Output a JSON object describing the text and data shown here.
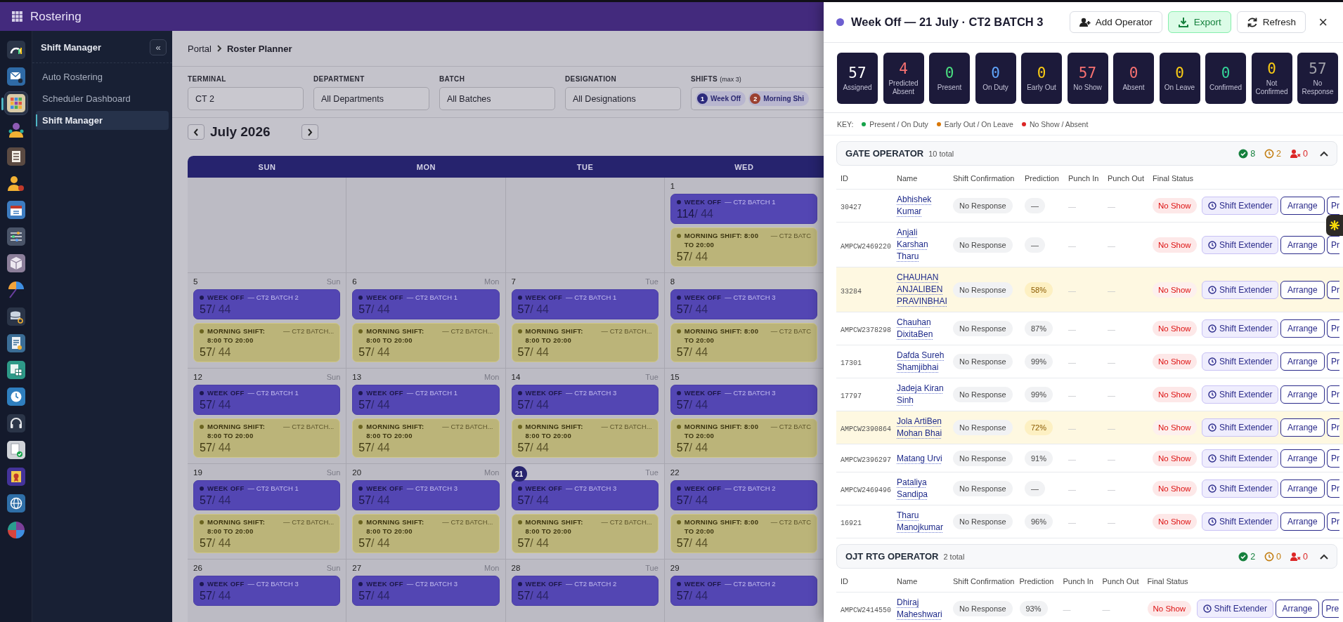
{
  "app": {
    "title": "Rostering"
  },
  "rail": [
    {
      "kind": "gauge",
      "selected": false
    },
    {
      "kind": "mail",
      "selected": false
    },
    {
      "kind": "apps",
      "selected": true
    },
    {
      "kind": "people",
      "selected": false
    },
    {
      "kind": "list",
      "selected": false
    },
    {
      "kind": "person",
      "selected": false
    },
    {
      "kind": "calendar",
      "selected": false
    },
    {
      "kind": "sliders",
      "selected": false
    },
    {
      "kind": "box",
      "selected": false
    },
    {
      "kind": "umbrella",
      "selected": false
    },
    {
      "kind": "database",
      "selected": false
    },
    {
      "kind": "report",
      "selected": false
    },
    {
      "kind": "sheet",
      "selected": false
    },
    {
      "kind": "clock",
      "selected": false
    },
    {
      "kind": "headset",
      "selected": false
    },
    {
      "kind": "approval",
      "selected": false
    },
    {
      "kind": "certificate",
      "selected": false
    },
    {
      "kind": "globe",
      "selected": false
    },
    {
      "kind": "pie",
      "selected": false
    }
  ],
  "sidebar": {
    "title": "Shift Manager",
    "collapse_label": "«",
    "items": [
      {
        "label": "Auto Rostering",
        "selected": false
      },
      {
        "label": "Scheduler Dashboard",
        "selected": false
      },
      {
        "label": "Shift Manager",
        "selected": true
      }
    ]
  },
  "breadcrumb": [
    {
      "label": "Portal",
      "current": false
    },
    {
      "label": "Roster Planner",
      "current": true
    }
  ],
  "filters": [
    {
      "label": "TERMINAL",
      "value": "CT 2"
    },
    {
      "label": "DEPARTMENT",
      "value": "All Departments"
    },
    {
      "label": "BATCH",
      "value": "All Batches"
    },
    {
      "label": "DESIGNATION",
      "value": "All Designations"
    }
  ],
  "shift_filter": {
    "label": "SHIFTS",
    "hint": "(max 3)",
    "chips": [
      {
        "number": "1",
        "label": "Week Off",
        "color": "#2c2a7c"
      },
      {
        "number": "2",
        "label": "Morning Shi",
        "color": "#9b4030"
      }
    ]
  },
  "calendar": {
    "month": "July 2026",
    "weekdays": [
      "SUN",
      "MON",
      "TUE",
      "WED"
    ],
    "weeks": [
      [
        {
          "day": "1",
          "today": false,
          "shifts": [
            {
              "kind": "week_off",
              "label": "WEEK OFF",
              "batch": "— CT2 BATCH 1",
              "headcount": "**114**/ 44"
            },
            {
              "kind": "morning",
              "label": "MORNING SHIFT: 8:00 TO 20:00",
              "batch": "— CT2 BATC",
              "headcount": "**57**/ 44"
            }
          ]
        }
      ],
      [
        {
          "day": "5",
          "weekday": "Sun",
          "today": false,
          "shifts": [
            {
              "kind": "week_off",
              "label": "WEEK OFF",
              "batch": "— CT2 BATCH 2",
              "headcount": "**57**/ 44"
            },
            {
              "kind": "morning",
              "label": "MORNING SHIFT: 8:00 TO 20:00",
              "batch": "— CT2 BATCH...",
              "headcount": "**57**/ 44"
            }
          ]
        },
        {
          "day": "6",
          "weekday": "Mon",
          "today": false,
          "shifts": [
            {
              "kind": "week_off",
              "label": "WEEK OFF",
              "batch": "— CT2 BATCH 1",
              "headcount": "**57**/ 44"
            },
            {
              "kind": "morning",
              "label": "MORNING SHIFT: 8:00 TO 20:00",
              "batch": "— CT2 BATCH...",
              "headcount": "**57**/ 44"
            }
          ]
        },
        {
          "day": "7",
          "weekday": "Tue",
          "today": false,
          "shifts": [
            {
              "kind": "week_off",
              "label": "WEEK OFF",
              "batch": "— CT2 BATCH 1",
              "headcount": "**57**/ 44"
            },
            {
              "kind": "morning",
              "label": "MORNING SHIFT: 8:00 TO 20:00",
              "batch": "— CT2 BATCH...",
              "headcount": "**57**/ 44"
            }
          ]
        },
        {
          "day": "8",
          "today": false,
          "shifts": [
            {
              "kind": "week_off",
              "label": "WEEK OFF",
              "batch": "— CT2 BATCH 3",
              "headcount": "**57**/ 44"
            },
            {
              "kind": "morning",
              "label": "MORNING SHIFT: 8:00 TO 20:00",
              "batch": "— CT2 BATC",
              "headcount": "**57**/ 44"
            }
          ]
        }
      ],
      [
        {
          "day": "12",
          "weekday": "Sun",
          "today": false,
          "shifts": [
            {
              "kind": "week_off",
              "label": "WEEK OFF",
              "batch": "— CT2 BATCH 1",
              "headcount": "**57**/ 44"
            },
            {
              "kind": "morning",
              "label": "MORNING SHIFT: 8:00 TO 20:00",
              "batch": "— CT2 BATCH...",
              "headcount": "**57**/ 44"
            }
          ]
        },
        {
          "day": "13",
          "weekday": "Mon",
          "today": false,
          "shifts": [
            {
              "kind": "week_off",
              "label": "WEEK OFF",
              "batch": "— CT2 BATCH 1",
              "headcount": "**57**/ 44"
            },
            {
              "kind": "morning",
              "label": "MORNING SHIFT: 8:00 TO 20:00",
              "batch": "— CT2 BATCH...",
              "headcount": "**57**/ 44"
            }
          ]
        },
        {
          "day": "14",
          "weekday": "Tue",
          "today": false,
          "shifts": [
            {
              "kind": "week_off",
              "label": "WEEK OFF",
              "batch": "— CT2 BATCH 3",
              "headcount": "**57**/ 44"
            },
            {
              "kind": "morning",
              "label": "MORNING SHIFT: 8:00 TO 20:00",
              "batch": "— CT2 BATCH...",
              "headcount": "**57**/ 44"
            }
          ]
        },
        {
          "day": "15",
          "today": false,
          "shifts": [
            {
              "kind": "week_off",
              "label": "WEEK OFF",
              "batch": "— CT2 BATCH 3",
              "headcount": "**57**/ 44"
            },
            {
              "kind": "morning",
              "label": "MORNING SHIFT: 8:00 TO 20:00",
              "batch": "— CT2 BATC",
              "headcount": "**57**/ 44"
            }
          ]
        }
      ],
      [
        {
          "day": "19",
          "weekday": "Sun",
          "today": false,
          "shifts": [
            {
              "kind": "week_off",
              "label": "WEEK OFF",
              "batch": "— CT2 BATCH 1",
              "headcount": "**57**/ 44"
            },
            {
              "kind": "morning",
              "label": "MORNING SHIFT: 8:00 TO 20:00",
              "batch": "— CT2 BATCH...",
              "headcount": "**57**/ 44"
            }
          ]
        },
        {
          "day": "20",
          "weekday": "Mon",
          "today": false,
          "shifts": [
            {
              "kind": "week_off",
              "label": "WEEK OFF",
              "batch": "— CT2 BATCH 3",
              "headcount": "**57**/ 44"
            },
            {
              "kind": "morning",
              "label": "MORNING SHIFT: 8:00 TO 20:00",
              "batch": "— CT2 BATCH...",
              "headcount": "**57**/ 44"
            }
          ]
        },
        {
          "day": "21",
          "weekday": "Tue",
          "today": true,
          "shifts": [
            {
              "kind": "week_off",
              "label": "WEEK OFF",
              "batch": "— CT2 BATCH 3",
              "headcount": "**57**/ 44"
            },
            {
              "kind": "morning",
              "label": "MORNING SHIFT: 8:00 TO 20:00",
              "batch": "— CT2 BATCH...",
              "headcount": "**57**/ 44"
            }
          ]
        },
        {
          "day": "22",
          "today": false,
          "shifts": [
            {
              "kind": "week_off",
              "label": "WEEK OFF",
              "batch": "— CT2 BATCH 2",
              "headcount": "**57**/ 44"
            },
            {
              "kind": "morning",
              "label": "MORNING SHIFT: 8:00 TO 20:00",
              "batch": "— CT2 BATC",
              "headcount": "**57**/ 44"
            }
          ]
        }
      ],
      [
        {
          "day": "26",
          "weekday": "Sun",
          "today": false,
          "shifts": [
            {
              "kind": "week_off",
              "label": "WEEK OFF",
              "batch": "— CT2 BATCH 3",
              "headcount": "**57**/ 44"
            }
          ]
        },
        {
          "day": "27",
          "weekday": "Mon",
          "today": false,
          "shifts": [
            {
              "kind": "week_off",
              "label": "WEEK OFF",
              "batch": "— CT2 BATCH 3",
              "headcount": "**57**/ 44"
            }
          ]
        },
        {
          "day": "28",
          "weekday": "Tue",
          "today": false,
          "shifts": [
            {
              "kind": "week_off",
              "label": "WEEK OFF",
              "batch": "— CT2 BATCH 2",
              "headcount": "**57**/ 44"
            }
          ]
        },
        {
          "day": "29",
          "today": false,
          "shifts": [
            {
              "kind": "week_off",
              "label": "WEEK OFF",
              "batch": "— CT2 BATCH 2",
              "headcount": "**57**/ 44"
            }
          ]
        }
      ]
    ]
  },
  "drawer": {
    "title": "Week Off — 21 July · CT2 BATCH 3",
    "buttons": [
      {
        "kind": "add",
        "label": "Add Operator"
      },
      {
        "kind": "export",
        "label": "Export"
      },
      {
        "kind": "refresh",
        "label": "Refresh"
      }
    ],
    "close": "×",
    "stats": [
      {
        "value": "57",
        "label": "Assigned",
        "color": "#ffffff"
      },
      {
        "value": "4",
        "label": "Predicted Absent",
        "color": "#f87171"
      },
      {
        "value": "0",
        "label": "Present",
        "color": "#4ade80"
      },
      {
        "value": "0",
        "label": "On Duty",
        "color": "#60a5fa"
      },
      {
        "value": "0",
        "label": "Early Out",
        "color": "#facc15"
      },
      {
        "value": "57",
        "label": "No Show",
        "color": "#f87171"
      },
      {
        "value": "0",
        "label": "Absent",
        "color": "#f87171"
      },
      {
        "value": "0",
        "label": "On Leave",
        "color": "#facc15"
      },
      {
        "value": "0",
        "label": "Confirmed",
        "color": "#34d399"
      },
      {
        "value": "0",
        "label": "Not Confirmed",
        "color": "#facc15"
      },
      {
        "value": "57",
        "label": "No Response",
        "color": "#a1a1aa"
      }
    ],
    "key_title": "KEY:",
    "key": [
      {
        "label": "Present / On Duty",
        "color": "#16a34a"
      },
      {
        "label": "Early Out / On Leave",
        "color": "#d97706"
      },
      {
        "label": "No Show / Absent",
        "color": "#dc2626"
      }
    ],
    "groups": [
      {
        "title": "GATE OPERATOR",
        "total": "10 total",
        "expanded": true,
        "counts": [
          {
            "kind": "ok",
            "value": "8"
          },
          {
            "kind": "pending",
            "value": "2"
          },
          {
            "kind": "absent",
            "value": "0"
          }
        ],
        "columns": [
          "ID",
          "Name",
          "Shift Confirmation",
          "Prediction",
          "Punch In",
          "Punch Out",
          "Final Status"
        ],
        "rows": [
          {
            "id": "30427",
            "name": "Abhishek Kumar",
            "confirmation": "No Response",
            "prediction": "—",
            "punch_in": "—",
            "punch_out": "—",
            "final_status": "No Show",
            "flagged": false,
            "actions": [
              "Shift Extender",
              "Arrange",
              "Pr"
            ]
          },
          {
            "id": "AMPCW2469220",
            "name": "Anjali Karshan Tharu",
            "confirmation": "No Response",
            "prediction": "—",
            "punch_in": "—",
            "punch_out": "—",
            "final_status": "No Show",
            "flagged": false,
            "actions": [
              "Shift Extender",
              "Arrange",
              "Pr"
            ]
          },
          {
            "id": "33284",
            "name": "CHAUHAN ANJALIBEN PRAVINBHAI",
            "confirmation": "No Response",
            "prediction": "58%",
            "punch_in": "—",
            "punch_out": "—",
            "final_status": "No Show",
            "flagged": true,
            "actions": [
              "Shift Extender",
              "Arrange",
              "Pr"
            ]
          },
          {
            "id": "AMPCW2378298",
            "name": "Chauhan DixitaBen",
            "confirmation": "No Response",
            "prediction": "87%",
            "punch_in": "—",
            "punch_out": "—",
            "final_status": "No Show",
            "flagged": false,
            "actions": [
              "Shift Extender",
              "Arrange",
              "Pr"
            ]
          },
          {
            "id": "17301",
            "name": "Dafda Sureh Shamjibhai",
            "confirmation": "No Response",
            "prediction": "99%",
            "punch_in": "—",
            "punch_out": "—",
            "final_status": "No Show",
            "flagged": false,
            "actions": [
              "Shift Extender",
              "Arrange",
              "Pr"
            ]
          },
          {
            "id": "17797",
            "name": "Jadeja Kiran Sinh",
            "confirmation": "No Response",
            "prediction": "99%",
            "punch_in": "—",
            "punch_out": "—",
            "final_status": "No Show",
            "flagged": false,
            "actions": [
              "Shift Extender",
              "Arrange",
              "Pr"
            ]
          },
          {
            "id": "AMPCW2390864",
            "name": "Jola ArtiBen Mohan Bhai",
            "confirmation": "No Response",
            "prediction": "72%",
            "punch_in": "—",
            "punch_out": "—",
            "final_status": "No Show",
            "flagged": true,
            "actions": [
              "Shift Extender",
              "Arrange",
              "Pr"
            ]
          },
          {
            "id": "AMPCW2396297",
            "name": "Matang Urvi",
            "confirmation": "No Response",
            "prediction": "91%",
            "punch_in": "—",
            "punch_out": "—",
            "final_status": "No Show",
            "flagged": false,
            "actions": [
              "Shift Extender",
              "Arrange",
              "Pr"
            ]
          },
          {
            "id": "AMPCW2469496",
            "name": "Pataliya Sandipa",
            "confirmation": "No Response",
            "prediction": "—",
            "punch_in": "—",
            "punch_out": "—",
            "final_status": "No Show",
            "flagged": false,
            "actions": [
              "Shift Extender",
              "Arrange",
              "Pr"
            ]
          },
          {
            "id": "16921",
            "name": "Tharu Manojkumar",
            "confirmation": "No Response",
            "prediction": "96%",
            "punch_in": "—",
            "punch_out": "—",
            "final_status": "No Show",
            "flagged": false,
            "actions": [
              "Shift Extender",
              "Arrange",
              "Pr"
            ]
          }
        ]
      },
      {
        "title": "OJT RTG OPERATOR",
        "total": "2 total",
        "expanded": true,
        "counts": [
          {
            "kind": "ok",
            "value": "2"
          },
          {
            "kind": "pending",
            "value": "0"
          },
          {
            "kind": "absent",
            "value": "0"
          }
        ],
        "columns": [
          "ID",
          "Name",
          "Shift Confirmation",
          "Prediction",
          "Punch In",
          "Punch Out",
          "Final Status"
        ],
        "rows": [
          {
            "id": "AMPCW2414550",
            "name": "Dhiraj Maheshwari",
            "confirmation": "No Response",
            "prediction": "93%",
            "punch_in": "—",
            "punch_out": "—",
            "final_status": "No Show",
            "flagged": false,
            "actions": [
              "Shift Extender",
              "Arrange",
              "Pre"
            ]
          }
        ]
      }
    ]
  }
}
